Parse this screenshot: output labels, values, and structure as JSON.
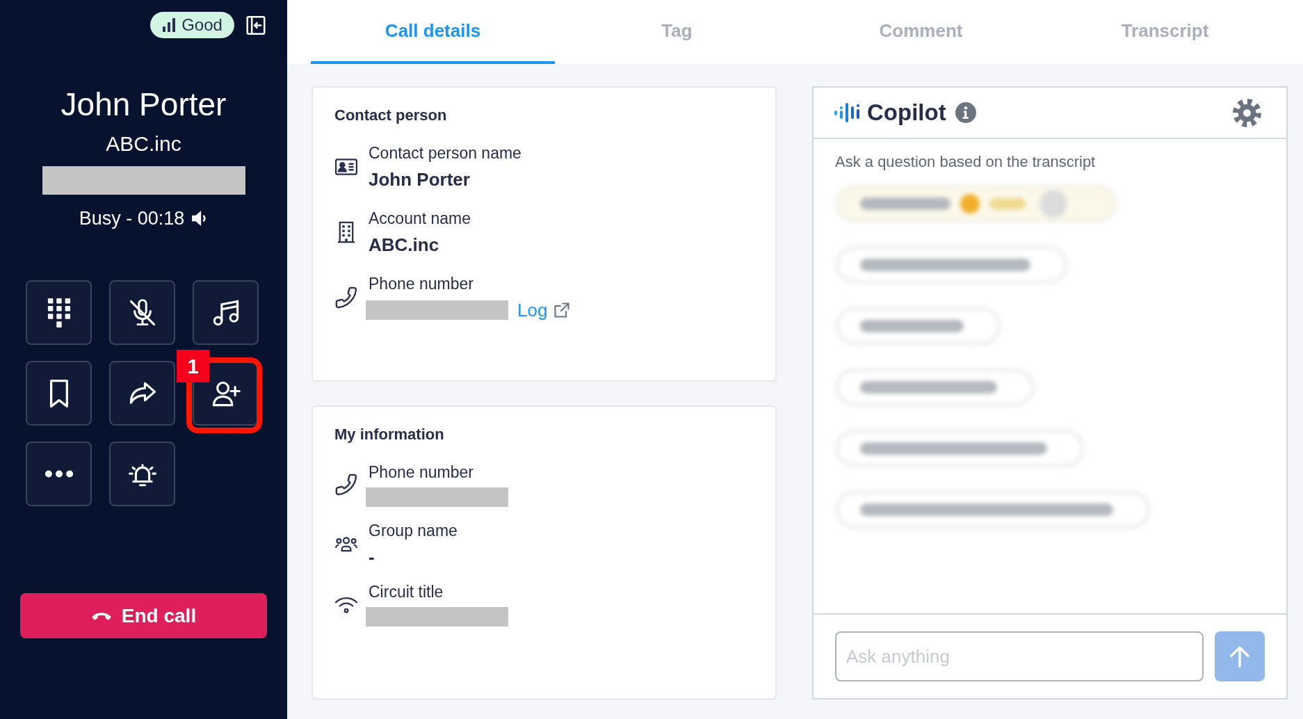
{
  "sidebar": {
    "connection_quality": "Good",
    "caller": {
      "name": "John Porter",
      "company": "ABC.inc",
      "number_redacted": true
    },
    "call_status": "Busy - 00:18",
    "call_controls": [
      {
        "highlighted": false
      },
      {
        "highlighted": false
      },
      {
        "highlighted": false
      },
      {
        "highlighted": false
      },
      {
        "highlighted": false
      },
      {
        "highlighted": true,
        "annotation": "1"
      },
      {
        "highlighted": false
      },
      {
        "highlighted": false
      }
    ],
    "end_call_label": "End call"
  },
  "tabs": [
    {
      "label": "Call details",
      "selected": true
    },
    {
      "label": "Tag",
      "selected": false
    },
    {
      "label": "Comment",
      "selected": false
    },
    {
      "label": "Transcript",
      "selected": false
    }
  ],
  "contact_person": {
    "title": "Contact person",
    "fields": [
      {
        "label": "Contact person name",
        "value": "John Porter",
        "redacted": false
      },
      {
        "label": "Account name",
        "value": "ABC.inc",
        "redacted": false
      },
      {
        "label": "Phone number",
        "redacted": true,
        "link": "Log"
      }
    ]
  },
  "my_information": {
    "title": "My information",
    "fields": [
      {
        "label": "Phone number",
        "redacted": true
      },
      {
        "label": "Group name",
        "value": "-",
        "redacted": false
      },
      {
        "label": "Circuit title",
        "redacted": true
      }
    ]
  },
  "copilot": {
    "title": "Copilot",
    "prompt": "Ask a question based on the transcript",
    "blurred_suggestions": [
      {
        "kind": "highlighted"
      },
      {
        "kind": "plain"
      },
      {
        "kind": "plain"
      },
      {
        "kind": "plain"
      },
      {
        "kind": "plain"
      },
      {
        "kind": "plain"
      }
    ],
    "input": {
      "placeholder": "Ask anything"
    }
  }
}
